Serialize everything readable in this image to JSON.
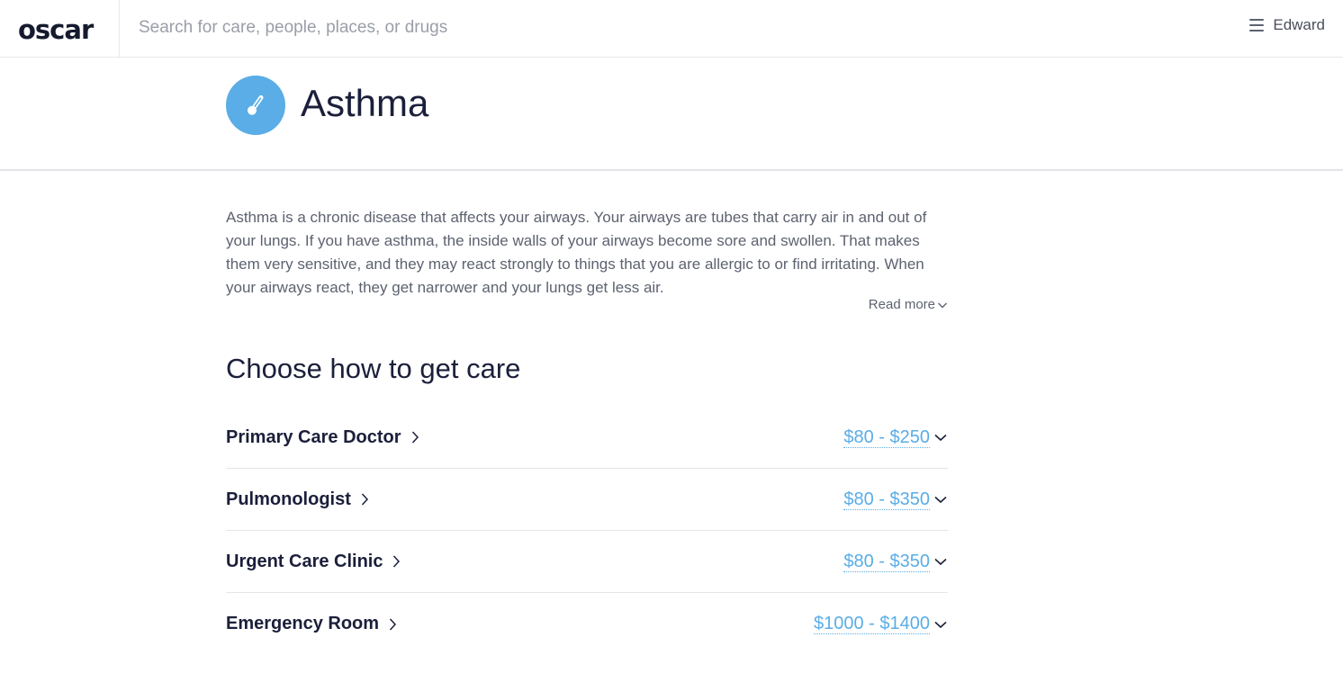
{
  "header": {
    "logo": "oscar",
    "search_placeholder": "Search for care, people, places, or drugs",
    "user_name": "Edward"
  },
  "condition": {
    "title": "Asthma",
    "icon": "thermometer-icon",
    "description": "Asthma is a chronic disease that affects your airways. Your airways are tubes that carry air in and out of your lungs. If you have asthma, the inside walls of your airways become sore and swollen. That makes them very sensitive, and they may react strongly to things that you are allergic to or find irritating. When your airways react, they get narrower and your lungs get less air.",
    "read_more": "Read more"
  },
  "care": {
    "section_title": "Choose how to get care",
    "options": [
      {
        "name": "Primary Care Doctor",
        "price": "$80 - $250"
      },
      {
        "name": "Pulmonologist",
        "price": "$80 - $350"
      },
      {
        "name": "Urgent Care Clinic",
        "price": "$80 - $350"
      },
      {
        "name": "Emergency Room",
        "price": "$1000 - $1400"
      }
    ]
  },
  "colors": {
    "accent": "#5aade6",
    "heading": "#1b1f3a",
    "body_text": "#5d6270"
  }
}
